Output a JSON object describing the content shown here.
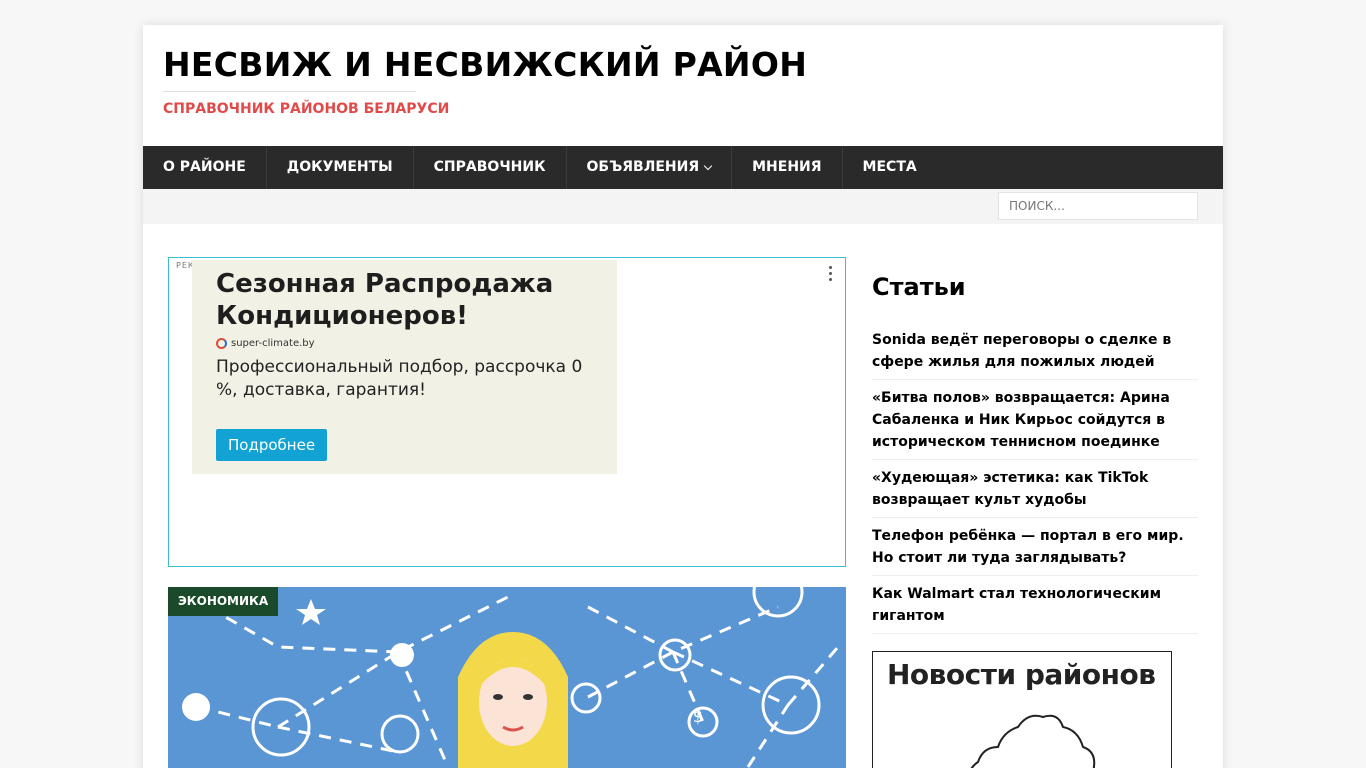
{
  "header": {
    "title": "НЕСВИЖ И НЕСВИЖСКИЙ РАЙОН",
    "description": "СПРАВОЧНИК РАЙОНОВ БЕЛАРУСИ"
  },
  "nav": {
    "items": [
      {
        "label": "О РАЙОНЕ"
      },
      {
        "label": "ДОКУМЕНТЫ"
      },
      {
        "label": "СПРАВОЧНИК"
      },
      {
        "label": "ОБЪЯВЛЕНИЯ"
      },
      {
        "label": "МНЕНИЯ"
      },
      {
        "label": "МЕСТА"
      }
    ]
  },
  "search": {
    "placeholder": "ПОИСК..."
  },
  "ad": {
    "label": "РЕКЛАМА",
    "title": "Сезонная Распродажа Кондиционеров!",
    "domain": "super-climate.by",
    "text": "Профессиональный подбор, рассрочка 0 %, доставка, гарантия!",
    "button": "Подробнее",
    "border_color": "#3dbdd1",
    "button_color": "#12a2d4"
  },
  "feature": {
    "category": "ЭКОНОМИКА",
    "badge_color": "#1a4a2a",
    "image_background": "#5b96d4"
  },
  "sidebar": {
    "title": "Статьи",
    "articles": [
      "Sonida ведёт переговоры о сделке в сфере жилья для пожилых людей",
      "«Битва полов» возвращается: Арина Сабаленка и Ник Кирьос сойдутся в историческом теннисном поединке",
      "«Худеющая» эстетика: как TikTok возвращает культ худобы",
      "Телефон ребёнка — портал в его мир. Но стоит ли туда заглядывать?",
      "Как Walmart стал технологическим гигантом"
    ],
    "news_banner": "Новости районов"
  },
  "colors": {
    "accent": "#e04b4a",
    "nav_bg": "#2a2a2a"
  }
}
